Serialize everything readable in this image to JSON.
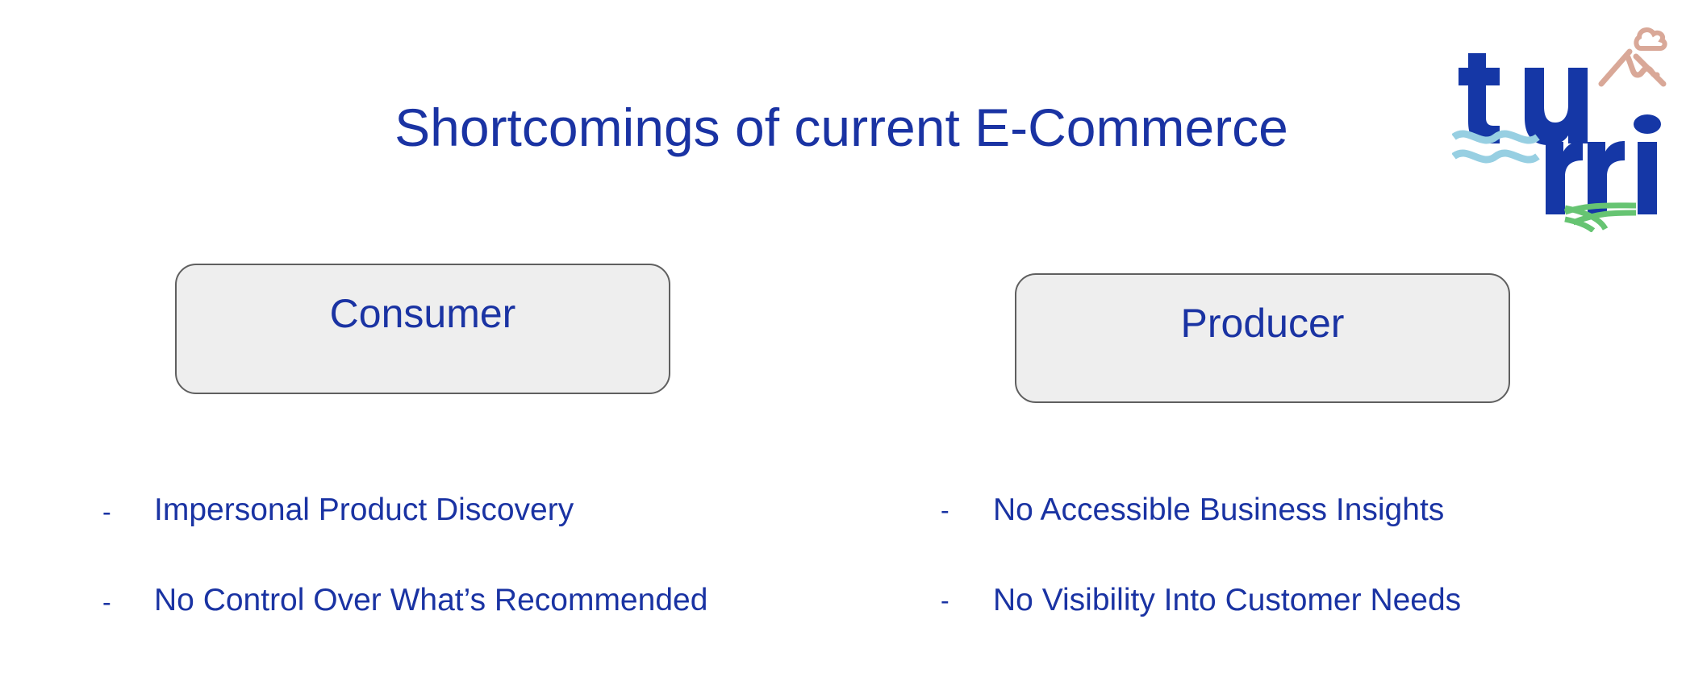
{
  "title": "Shortcomings of current E-Commerce",
  "logo": {
    "text": "turri",
    "colors": {
      "text": "#1537a6",
      "mountain": "#d9a898",
      "waves": "#97cfe2",
      "fields": "#66c472"
    }
  },
  "columns": [
    {
      "heading": "Consumer",
      "bullet": "-",
      "items": [
        "Impersonal Product Discovery",
        "No Control Over What’s Recommended"
      ]
    },
    {
      "heading": "Producer",
      "bullet": "-",
      "items": [
        "No Accessible Business Insights",
        "No Visibility Into Customer Needs"
      ]
    }
  ],
  "colors": {
    "text": "#1a33a3",
    "box_fill": "#eeeeee",
    "box_border": "#5f5f5f"
  }
}
